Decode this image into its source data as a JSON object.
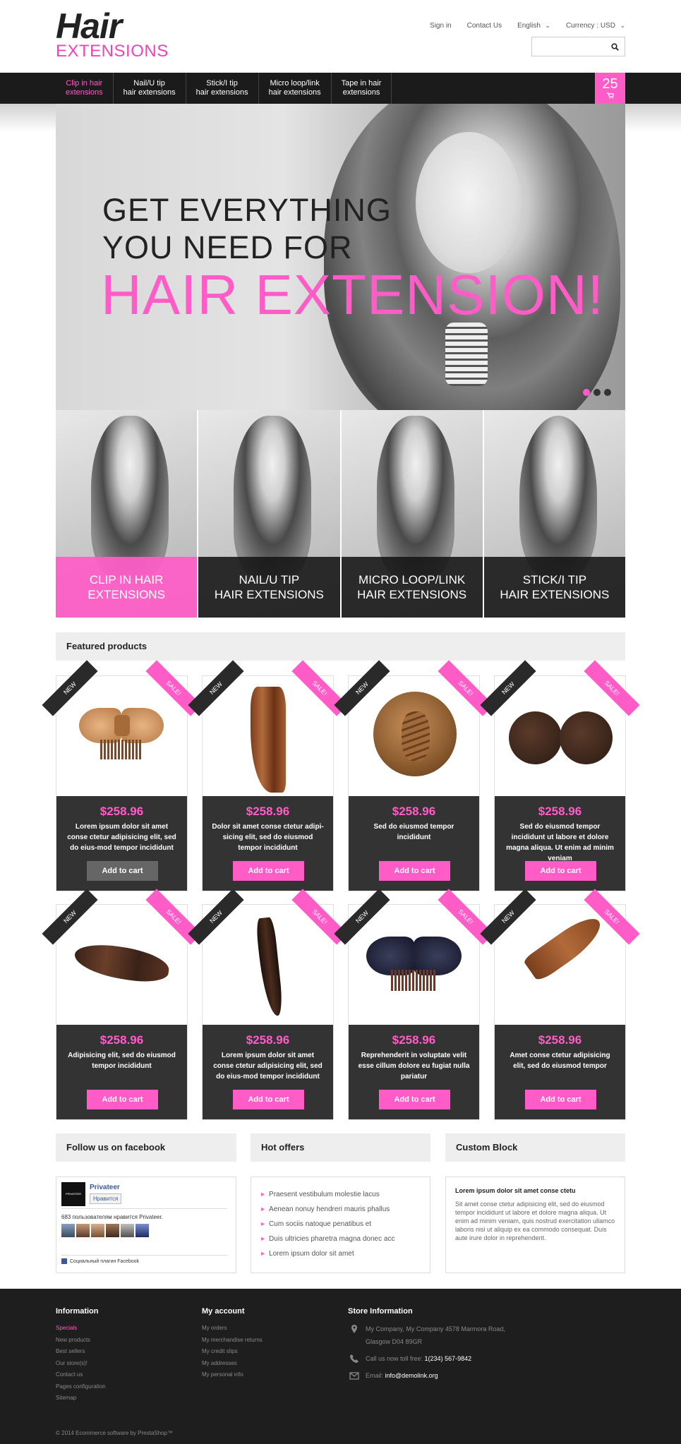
{
  "logo": {
    "line1": "Hair",
    "line2": "EXTENSIONS"
  },
  "toplinks": {
    "signin": "Sign in",
    "contact": "Contact Us",
    "language": "English",
    "currency": "Currency : USD"
  },
  "search": {
    "placeholder": ""
  },
  "nav": {
    "items": [
      {
        "label": "Clip in hair\nextensions"
      },
      {
        "label": "Nail/U tip\nhair extensions"
      },
      {
        "label": "Stick/I tip\nhair extensions"
      },
      {
        "label": "Micro loop/link\nhair extensions"
      },
      {
        "label": "Tape in hair\nextensions"
      }
    ],
    "cart_count": "25"
  },
  "slider": {
    "line1": "GET EVERYTHING",
    "line2": "YOU NEED FOR",
    "line3": "HAIR EXTENSION!"
  },
  "categories": [
    {
      "label": "CLIP IN HAIR\nEXTENSIONS"
    },
    {
      "label": "NAIL/U TIP\nHAIR EXTENSIONS"
    },
    {
      "label": "MICRO LOOP/LINK\nHAIR EXTENSIONS"
    },
    {
      "label": "STICK/I TIP\nHAIR EXTENSIONS"
    }
  ],
  "featured": {
    "title": "Featured products",
    "products": [
      {
        "price": "$258.96",
        "desc": "Lorem ipsum dolor sit amet conse ctetur adipisicing elit, sed do eius-mod tempor incididunt",
        "button": "Add to cart",
        "new": "NEW",
        "sale": "SALE!"
      },
      {
        "price": "$258.96",
        "desc": "Dolor sit amet conse ctetur adipi-sicing elit, sed do eiusmod tempor incididunt",
        "button": "Add to cart",
        "new": "NEW",
        "sale": "SALE!"
      },
      {
        "price": "$258.96",
        "desc": "Sed do eiusmod tempor incididunt",
        "button": "Add to cart",
        "new": "NEW",
        "sale": "SALE!"
      },
      {
        "price": "$258.96",
        "desc": "Sed do eiusmod tempor incididunt ut labore et dolore magna aliqua. Ut enim ad minim veniam",
        "button": "Add to cart",
        "new": "NEW",
        "sale": "SALE!"
      },
      {
        "price": "$258.96",
        "desc": "Adipisicing elit, sed do eiusmod tempor incididunt",
        "button": "Add to cart",
        "new": "NEW",
        "sale": "SALE!"
      },
      {
        "price": "$258.96",
        "desc": "Lorem ipsum dolor sit amet conse ctetur adipisicing elit, sed do eius-mod tempor incididunt",
        "button": "Add to cart",
        "new": "NEW",
        "sale": "SALE!"
      },
      {
        "price": "$258.96",
        "desc": "Reprehenderit in voluptate velit esse cillum dolore eu fugiat nulla pariatur",
        "button": "Add to cart",
        "new": "NEW",
        "sale": "SALE!"
      },
      {
        "price": "$258.96",
        "desc": "Amet conse ctetur adipisicing elit, sed do eiusmod tempor",
        "button": "Add to cart",
        "new": "NEW",
        "sale": "SALE!"
      }
    ]
  },
  "facebook": {
    "title": "Follow us on facebook",
    "page_name": "Privateer",
    "logo_text": "PRIVATEER",
    "like": "Нравится",
    "count": "683 пользователям нравится Privateer.",
    "plugin": "Социальный плагин Facebook"
  },
  "offers": {
    "title": "Hot offers",
    "items": [
      "Praesent vestibulum molestie lacus",
      "Aenean nonuy hendreri mauris phallus",
      "Cum sociis natoque penatibus et",
      "Duis ultricies pharetra magna donec acc",
      "Lorem ipsum dolor sit amet"
    ]
  },
  "custom": {
    "title": "Custom Block",
    "heading": "Lorem ipsum dolor sit amet conse ctetu",
    "body": "Sit amet conse ctetur adipisicing elit, sed do eiusmod tempor incididunt ut labore et dolore magna aliqua. Ut enim ad minim veniam, quis nostrud exercitation ullamco laboris nisi ut aliquip ex ea commodo consequat. Duis aute irure dolor in reprehenderit."
  },
  "footer": {
    "info_title": "Information",
    "info_links": [
      "Specials",
      "New products",
      "Best sellers",
      "Our store(s)!",
      "Contact us",
      "Pages configuration",
      "Sitemap"
    ],
    "account_title": "My account",
    "account_links": [
      "My orders",
      "My merchandise returns",
      "My credit slips",
      "My addresses",
      "My personal info"
    ],
    "store_title": "Store Information",
    "address": "My Company, My Company 4578 Marmora Road, Glasgow D04 89GR",
    "phone_label": "Call us now toll free: ",
    "phone": "1(234) 567-9842",
    "email_label": "Email: ",
    "email": "info@demolink.org",
    "copyright": "© 2014 Ecommerce software by PrestaShop™"
  },
  "colors": {
    "accent": "#ff5cc8",
    "dark": "#1b1b1b",
    "panel": "#333333"
  }
}
